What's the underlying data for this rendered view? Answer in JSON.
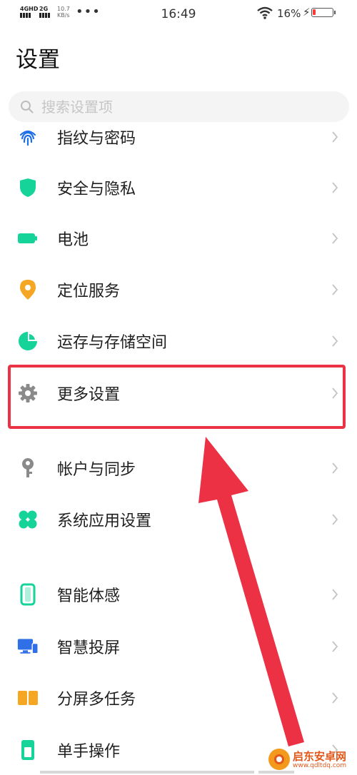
{
  "status_bar": {
    "signal1_label": "4GHD",
    "signal2_label": "2G",
    "net_speed": "10.7",
    "net_speed_unit": "KB/s",
    "more": "•••",
    "time": "16:49",
    "battery_percent": "16%",
    "battery_level": 0.16
  },
  "page": {
    "title": "设置"
  },
  "search": {
    "placeholder": "搜索设置项"
  },
  "items": [
    {
      "label": "指纹与密码",
      "icon": "fingerprint-icon",
      "color": "#1e6fe8"
    },
    {
      "label": "安全与隐私",
      "icon": "shield-icon",
      "color": "#16d39a"
    },
    {
      "label": "电池",
      "icon": "battery-icon",
      "color": "#16d39a"
    },
    {
      "label": "定位服务",
      "icon": "location-pin-icon",
      "color": "#f5a623"
    },
    {
      "label": "运存与存储空间",
      "icon": "pie-chart-icon",
      "color": "#16d39a"
    },
    {
      "label": "更多设置",
      "icon": "gear-icon",
      "color": "#8a8a8a"
    },
    {
      "label": "帐户与同步",
      "icon": "key-icon",
      "color": "#8a8a8a"
    },
    {
      "label": "系统应用设置",
      "icon": "clover-icon",
      "color": "#16d39a"
    },
    {
      "label": "智能体感",
      "icon": "phone-motion-icon",
      "color": "#16d39a"
    },
    {
      "label": "智慧投屏",
      "icon": "screen-cast-icon",
      "color": "#2f6fe8"
    },
    {
      "label": "分屏多任务",
      "icon": "split-screen-icon",
      "color": "#f5a623"
    },
    {
      "label": "单手操作",
      "icon": "one-hand-icon",
      "color": "#16d39a"
    }
  ],
  "watermark": {
    "title": "启东安卓网",
    "url": "www.qdltdq.com"
  },
  "colors": {
    "highlight": "#ec3145",
    "accent_green": "#16d39a"
  }
}
